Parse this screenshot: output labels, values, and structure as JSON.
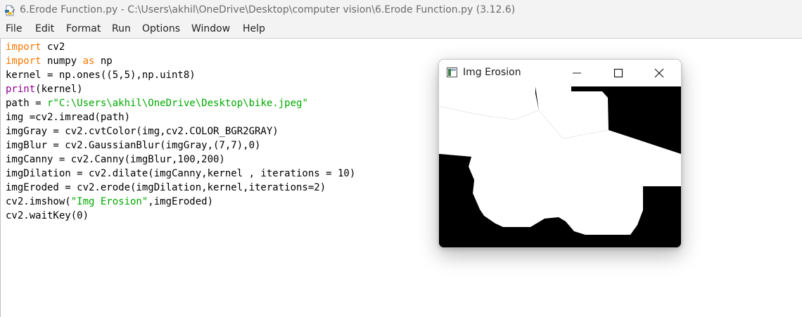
{
  "window": {
    "title": "6.Erode Function.py - C:\\Users\\akhil\\OneDrive\\Desktop\\computer vision\\6.Erode Function.py (3.12.6)",
    "icon": "python-file-icon"
  },
  "menu": {
    "items": [
      {
        "label": "File"
      },
      {
        "label": "Edit"
      },
      {
        "label": "Format"
      },
      {
        "label": "Run"
      },
      {
        "label": "Options"
      },
      {
        "label": "Window"
      },
      {
        "label": "Help"
      }
    ]
  },
  "code": {
    "lines": [
      [
        {
          "t": "import",
          "c": "kw"
        },
        {
          "t": " cv2"
        }
      ],
      [
        {
          "t": "import",
          "c": "kw"
        },
        {
          "t": " numpy "
        },
        {
          "t": "as",
          "c": "kw"
        },
        {
          "t": " np"
        }
      ],
      [
        {
          "t": "kernel = np.ones((5,5),np.uint8)"
        }
      ],
      [
        {
          "t": "print",
          "c": "bi"
        },
        {
          "t": "(kernel)"
        }
      ],
      [
        {
          "t": "path = "
        },
        {
          "t": "r\"C:\\Users\\akhil\\OneDrive\\Desktop\\bike.jpeg\"",
          "c": "st"
        }
      ],
      [
        {
          "t": "img =cv2.imread(path)"
        }
      ],
      [
        {
          "t": "imgGray = cv2.cvtColor(img,cv2.COLOR_BGR2GRAY)"
        }
      ],
      [
        {
          "t": "imgBlur = cv2.GaussianBlur(imgGray,(7,7),0)"
        }
      ],
      [
        {
          "t": "imgCanny = cv2.Canny(imgBlur,100,200)"
        }
      ],
      [
        {
          "t": "imgDilation = cv2.dilate(imgCanny,kernel , iterations = 10)"
        }
      ],
      [
        {
          "t": "imgEroded = cv2.erode(imgDilation,kernel,iterations=2)"
        }
      ],
      [
        {
          "t": "cv2.imshow("
        },
        {
          "t": "\"Img Erosion\"",
          "c": "st"
        },
        {
          "t": ",imgEroded)"
        }
      ],
      [
        {
          "t": "cv2.waitKey(0)"
        }
      ]
    ]
  },
  "cv_window": {
    "title": "Img Erosion",
    "icon": "opencv-window-icon",
    "buttons": {
      "minimize": "minimize-icon",
      "maximize": "maximize-icon",
      "close": "close-icon"
    },
    "image": {
      "description_colors": {
        "foreground": "#ffffff",
        "background": "#000000"
      }
    }
  },
  "colors": {
    "keyword": "#ff7700",
    "builtin": "#900090",
    "string": "#00aa00",
    "chrome": "#f3f3f3"
  }
}
